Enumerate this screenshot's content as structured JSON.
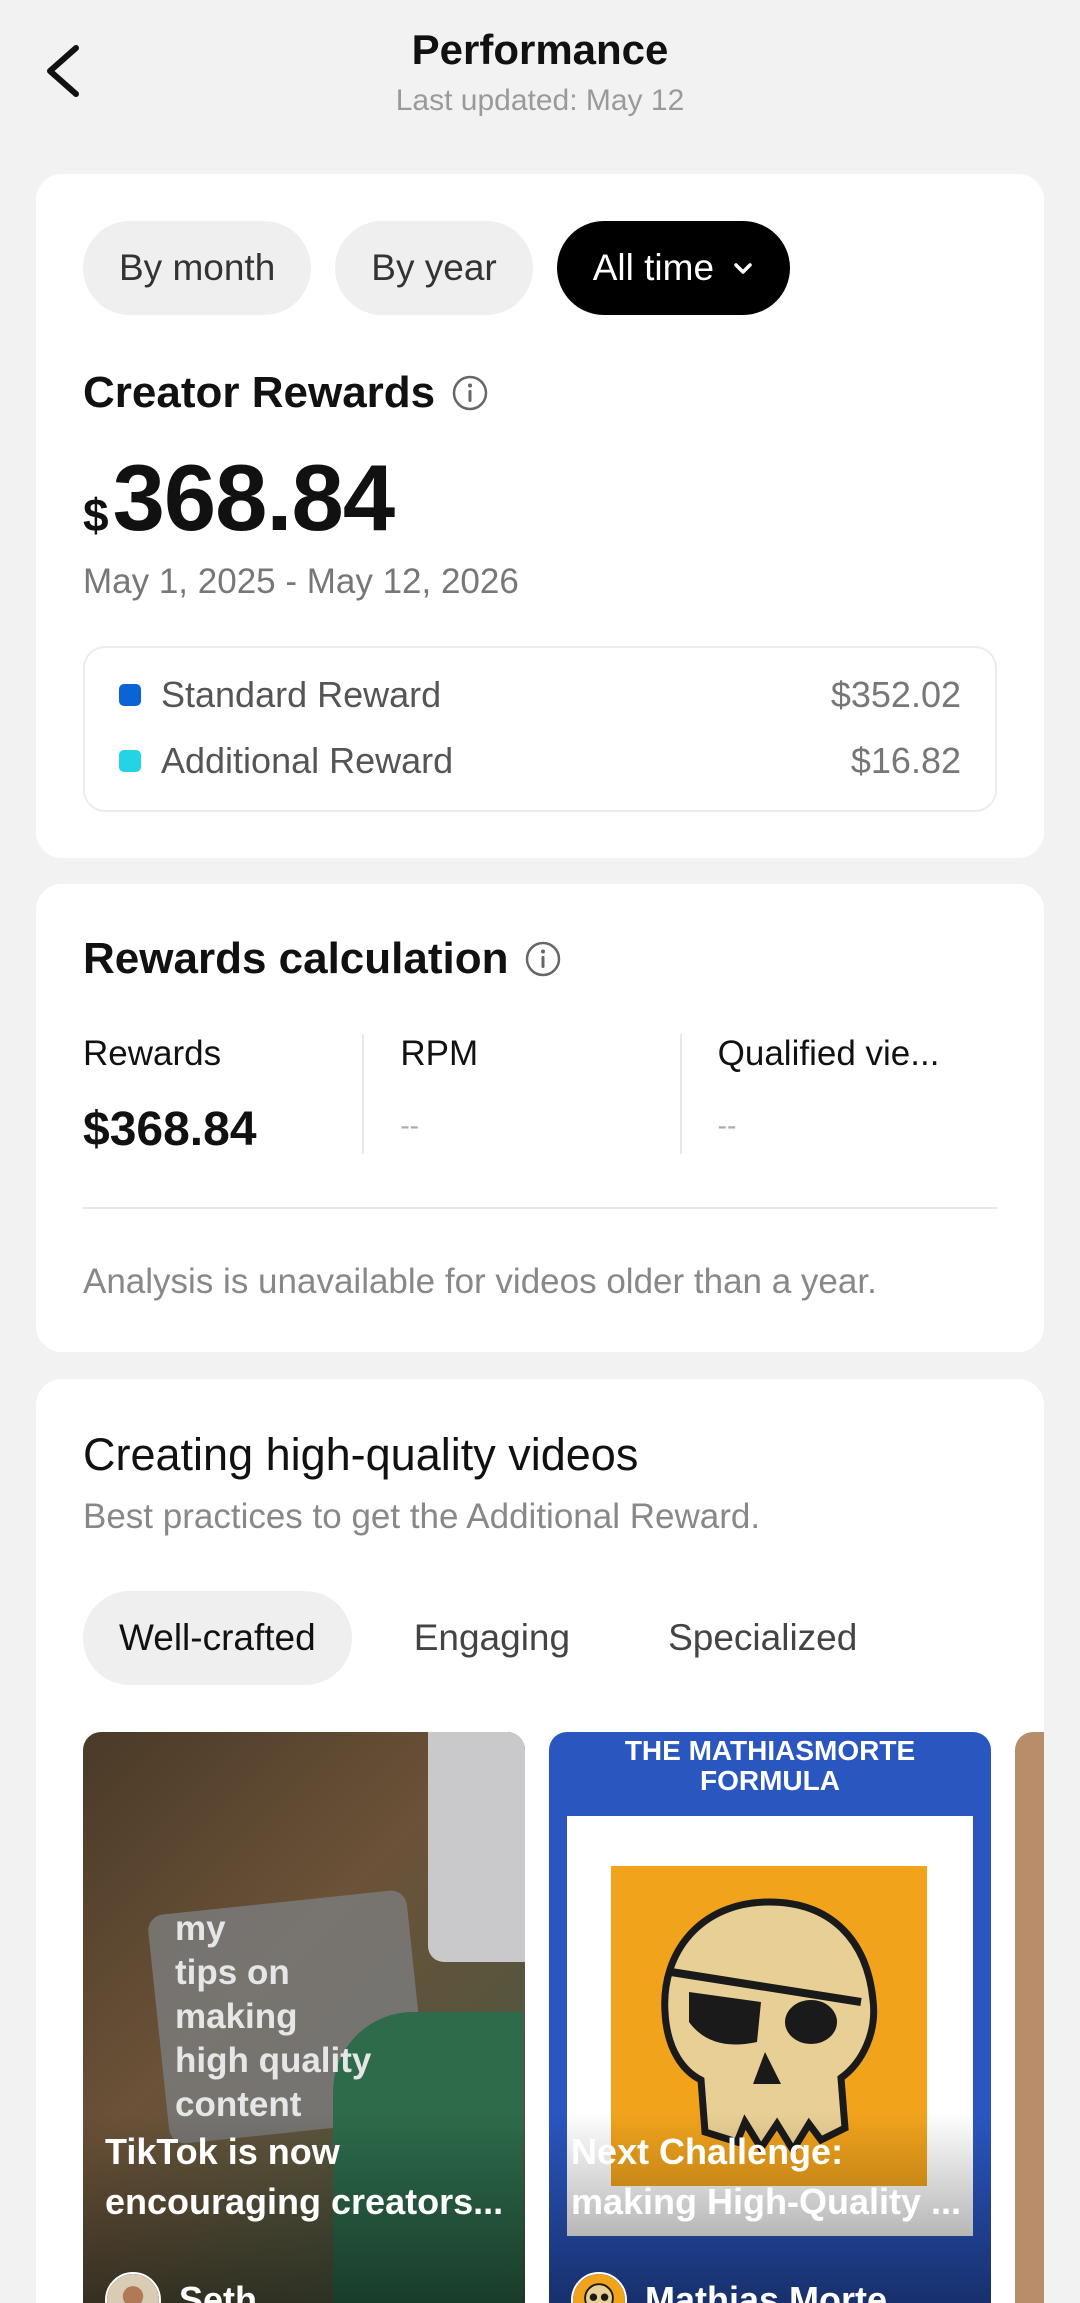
{
  "header": {
    "title": "Performance",
    "subtitle": "Last updated: May 12"
  },
  "period_tabs": [
    {
      "label": "By month",
      "active": false
    },
    {
      "label": "By year",
      "active": false
    },
    {
      "label": "All time",
      "active": true
    }
  ],
  "creator_rewards": {
    "title": "Creator Rewards",
    "currency": "$",
    "amount": "368.84",
    "date_range": "May 1, 2025 - May 12, 2026",
    "breakdown": [
      {
        "label": "Standard Reward",
        "value": "$352.02",
        "color": "#0b63d4"
      },
      {
        "label": "Additional Reward",
        "value": "$16.82",
        "color": "#24d3e6"
      }
    ]
  },
  "rewards_calculation": {
    "title": "Rewards calculation",
    "metrics": [
      {
        "label": "Rewards",
        "value": "$368.84"
      },
      {
        "label": "RPM",
        "value": "--"
      },
      {
        "label": "Qualified vie...",
        "value": "--"
      }
    ],
    "note": "Analysis is unavailable for videos older than a year."
  },
  "high_quality": {
    "title": "Creating high-quality videos",
    "subtitle": "Best practices to get the Additional Reward.",
    "tabs": [
      {
        "label": "Well-crafted",
        "active": true
      },
      {
        "label": "Engaging",
        "active": false
      },
      {
        "label": "Specialized",
        "active": false
      }
    ],
    "videos": [
      {
        "overlay_lines": [
          "my",
          "tips on",
          "making",
          "high quality",
          "content"
        ],
        "caption_line1": "TikTok is now",
        "caption_line2": "encouraging creators...",
        "author": "Seth"
      },
      {
        "banner_line1": "THE MATHIASMORTE",
        "banner_line2": "FORMULA",
        "caption_line1": "Next Challenge:",
        "caption_line2": "making High-Quality ...",
        "author": "Mathias Morte"
      }
    ]
  }
}
